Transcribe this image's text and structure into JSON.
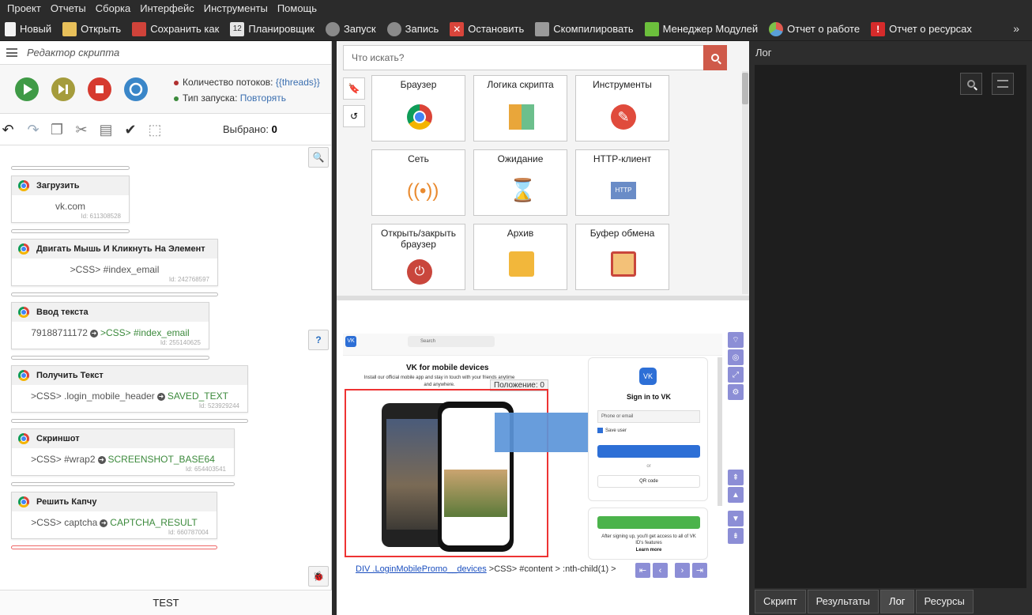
{
  "menu": [
    "Проект",
    "Отчеты",
    "Сборка",
    "Интерфейс",
    "Инструменты",
    "Помощь"
  ],
  "toolbar": [
    {
      "label": "Новый",
      "icon": "new-file-icon",
      "color": "#f0f0f0"
    },
    {
      "label": "Открыть",
      "icon": "open-folder-icon",
      "color": "#e8c05a"
    },
    {
      "label": "Сохранить как",
      "icon": "save-icon",
      "color": "#d0433a"
    },
    {
      "label": "Планировщик",
      "icon": "calendar-icon",
      "color": "#dcdcdc"
    },
    {
      "label": "Запуск",
      "icon": "play-icon",
      "color": "#8a8a8a"
    },
    {
      "label": "Запись",
      "icon": "record-icon",
      "color": "#8a8a8a"
    },
    {
      "label": "Остановить",
      "icon": "stop-icon",
      "color": "#d9453b"
    },
    {
      "label": "Скомпилировать",
      "icon": "cube-icon",
      "color": "#9a9a9a"
    },
    {
      "label": "Менеджер Модулей",
      "icon": "puzzle-icon",
      "color": "#6cbf3c"
    },
    {
      "label": "Отчет о работе",
      "icon": "pie-chart-icon",
      "color": "#5aa0d8"
    },
    {
      "label": "Отчет о ресурсах",
      "icon": "alert-icon",
      "color": "#d62b2b"
    }
  ],
  "toolbar_more": "»",
  "editor": {
    "title": "Редактор скрипта",
    "threads_label": "Количество потоков:",
    "threads_value": "{{threads}}",
    "launch_label": "Тип запуска:",
    "launch_value": "Повторять",
    "selected_label": "Выбрано:",
    "selected_value": "0",
    "test_label": "TEST"
  },
  "blocks": [
    {
      "title": "Загрузить",
      "value": "vk.com",
      "id": "Id: 611308528"
    },
    {
      "title": "Двигать Мышь И Кликнуть На Элемент",
      "value": ">CSS> #index_email",
      "id": "Id: 242768597"
    },
    {
      "title": "Ввод текста",
      "value_a": "79188711172",
      "value_b": ">CSS> #index_email",
      "id": "Id: 255140625"
    },
    {
      "title": "Получить Текст",
      "value_a": ">CSS> .login_mobile_header",
      "value_b": "SAVED_TEXT",
      "id": "Id: 523929244"
    },
    {
      "title": "Скриншот",
      "value_a": ">CSS> #wrap2",
      "value_b": "SCREENSHOT_BASE64",
      "id": "Id: 654403541"
    },
    {
      "title": "Решить Капчу",
      "value_a": ">CSS> captcha",
      "value_b": "CAPTCHA_RESULT",
      "id": "Id: 660787004"
    }
  ],
  "catalog": {
    "search_placeholder": "Что искать?",
    "cards": [
      "Браузер",
      "Логика скрипта",
      "Инструменты",
      "Сеть",
      "Ожидание",
      "HTTP-клиент",
      "Открыть/закрыть браузер",
      "Архив",
      "Буфер обмена"
    ]
  },
  "browser": {
    "search": "Search",
    "promo_title": "VK for mobile devices",
    "promo_text": "Install our official mobile app and stay in touch with your friends anytime and anywhere.",
    "position_label": "Положение: 0",
    "signin_title": "Sign in to VK",
    "phone_placeholder": "Phone or email",
    "save_user": "Save user",
    "or": "or",
    "qr": "QR code",
    "footer_text": "After signing up, you'll get access to all of VK ID's features",
    "learn_more": "Learn more",
    "path_link": "DIV .LoginMobilePromo__devices",
    "path_rest": ">CSS> #content > :nth-child(1) >"
  },
  "log": {
    "title": "Лог",
    "tabs": [
      "Скрипт",
      "Результаты",
      "Лог",
      "Ресурсы"
    ],
    "active_tab": "Лог"
  }
}
